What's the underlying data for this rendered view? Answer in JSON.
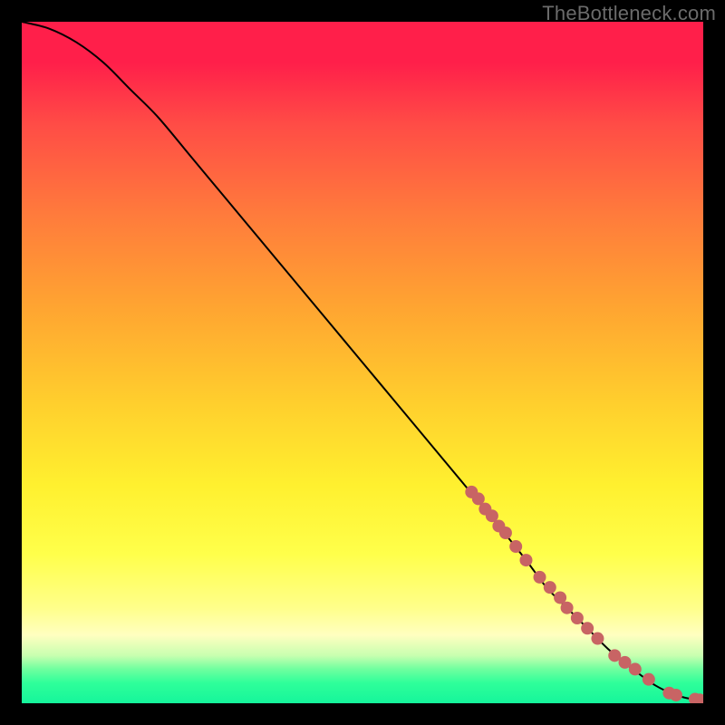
{
  "watermark": "TheBottleneck.com",
  "chart_data": {
    "type": "line",
    "title": "",
    "xlabel": "",
    "ylabel": "",
    "xlim": [
      0,
      100
    ],
    "ylim": [
      0,
      100
    ],
    "grid": false,
    "curve": {
      "x": [
        0,
        4,
        8,
        12,
        16,
        20,
        25,
        30,
        35,
        40,
        45,
        50,
        55,
        60,
        65,
        70,
        74,
        77,
        80,
        83,
        86,
        89,
        91,
        93,
        95,
        97,
        99,
        100
      ],
      "y": [
        100,
        99,
        97,
        94,
        90,
        86,
        80,
        74,
        68,
        62,
        56,
        50,
        44,
        38,
        32,
        26,
        21,
        17,
        14,
        11,
        8,
        5.5,
        4,
        2.6,
        1.6,
        0.9,
        0.5,
        0.4
      ]
    },
    "markers": {
      "color": "#c86464",
      "radius_css_px": 7,
      "x": [
        66,
        67,
        68,
        69,
        70,
        71,
        72.5,
        74,
        76,
        77.5,
        79,
        80,
        81.5,
        83,
        84.5,
        87,
        88.5,
        90,
        92,
        95,
        96,
        98.8,
        99.5
      ],
      "y": [
        31,
        30,
        28.5,
        27.5,
        26,
        25,
        23,
        21,
        18.5,
        17,
        15.5,
        14,
        12.5,
        11,
        9.5,
        7,
        6,
        5,
        3.5,
        1.5,
        1.2,
        0.6,
        0.5
      ]
    }
  }
}
